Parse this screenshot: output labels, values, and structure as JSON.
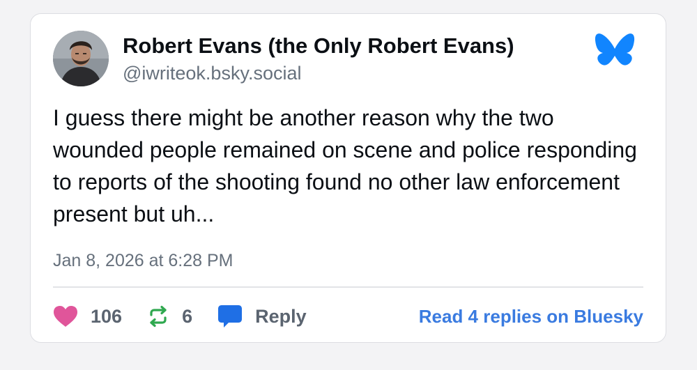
{
  "post": {
    "author": {
      "display_name": "Robert Evans (the Only Robert Evans)",
      "handle": "@iwriteok.bsky.social"
    },
    "text": "I guess there might be another reason why the two wounded people remained on scene and police responding to reports of the shooting found no other law enforcement present but uh...",
    "timestamp": "Jan 8, 2026 at 6:28 PM"
  },
  "actions": {
    "likes_count": "106",
    "reposts_count": "6",
    "reply_label": "Reply",
    "read_replies_label": "Read 4 replies on Bluesky"
  },
  "icons": {
    "logo": "bluesky-butterfly-icon",
    "like": "heart-icon",
    "repost": "repost-icon",
    "reply": "speech-bubble-icon"
  },
  "colors": {
    "brand": "#1185fe",
    "like": "#e0559a",
    "repost": "#2fa84f",
    "reply": "#1f6fe5",
    "link": "#3a7be0"
  }
}
